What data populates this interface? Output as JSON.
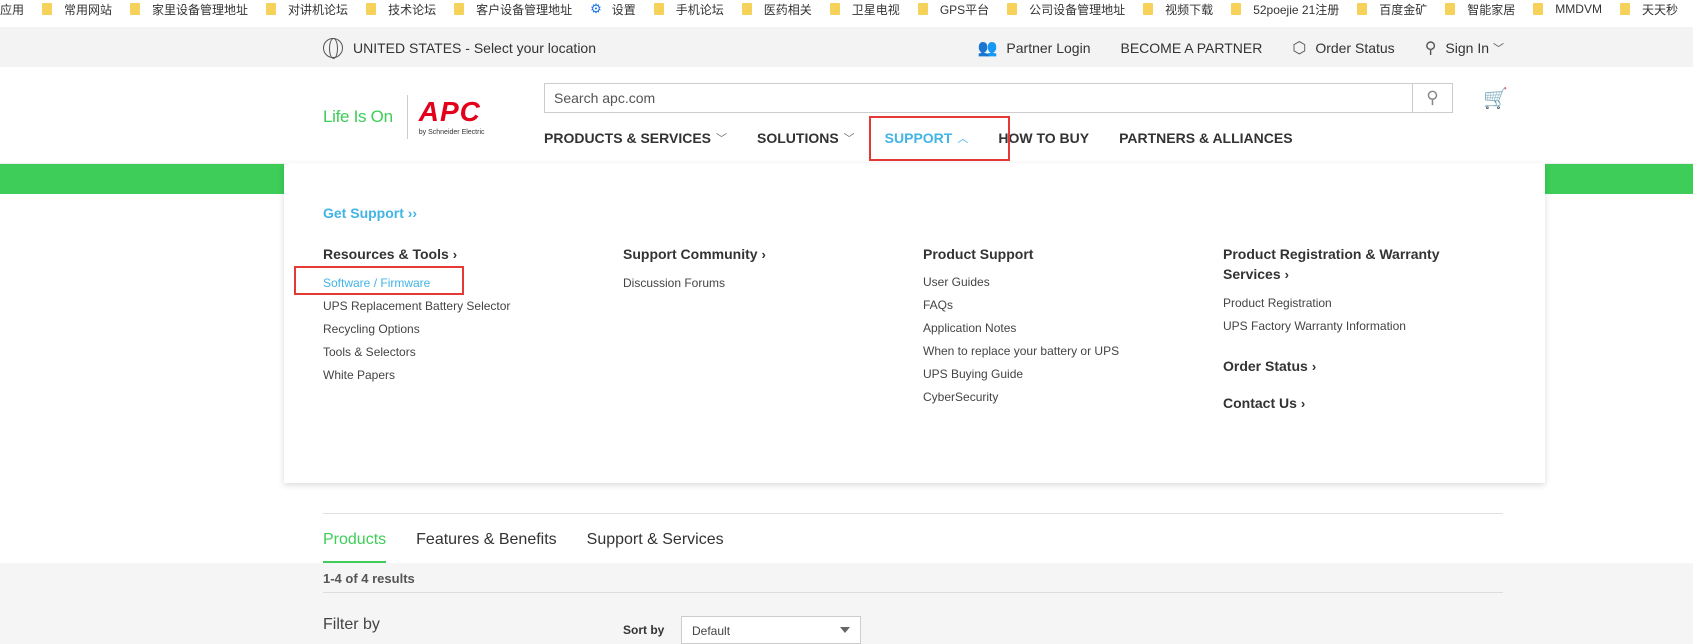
{
  "bookmarks": {
    "apps_label": "应用",
    "items": [
      "常用网站",
      "家里设备管理地址",
      "对讲机论坛",
      "技术论坛",
      "客户设备管理地址",
      "设置",
      "手机论坛",
      "医药相关",
      "卫星电视",
      "GPS平台",
      "公司设备管理地址",
      "视频下载",
      "52poejie 21注册",
      "百度金矿",
      "智能家居",
      "MMDVM",
      "天天秒"
    ]
  },
  "utility": {
    "location": "UNITED STATES - Select your location",
    "partner_login": "Partner Login",
    "become_partner": "BECOME A PARTNER",
    "order_status": "Order Status",
    "sign_in": "Sign In"
  },
  "brand": {
    "tagline": "Life Is On",
    "logo": "APC",
    "sub_logo": "by Schneider Electric"
  },
  "search": {
    "placeholder": "Search apc.com"
  },
  "nav": {
    "products": "PRODUCTS & SERVICES",
    "solutions": "SOLUTIONS",
    "support": "SUPPORT",
    "how_to_buy": "HOW TO BUY",
    "partners": "PARTNERS & ALLIANCES"
  },
  "mega": {
    "get_support": "Get Support ››",
    "resources": {
      "title": "Resources & Tools",
      "links": [
        "Software / Firmware",
        "UPS Replacement Battery Selector",
        "Recycling Options",
        "Tools & Selectors",
        "White Papers"
      ]
    },
    "community": {
      "title": "Support Community",
      "links": [
        "Discussion Forums"
      ]
    },
    "product_support": {
      "title": "Product Support",
      "links": [
        "User Guides",
        "FAQs",
        "Application Notes",
        "When to replace your battery or UPS",
        "UPS Buying Guide",
        "CyberSecurity"
      ]
    },
    "registration": {
      "title": "Product Registration & Warranty Services",
      "links": [
        "Product Registration",
        "UPS Factory Warranty Information"
      ],
      "order_status": "Order Status",
      "contact_us": "Contact Us"
    }
  },
  "tabs": [
    "Products",
    "Features & Benefits",
    "Support & Services"
  ],
  "results": "1-4 of 4 results",
  "filter_by": "Filter by",
  "sort_by": "Sort by",
  "sort_value": "Default",
  "colors": {
    "green": "#3dcd58",
    "blue": "#42b4e6",
    "red_box": "#e53935"
  }
}
